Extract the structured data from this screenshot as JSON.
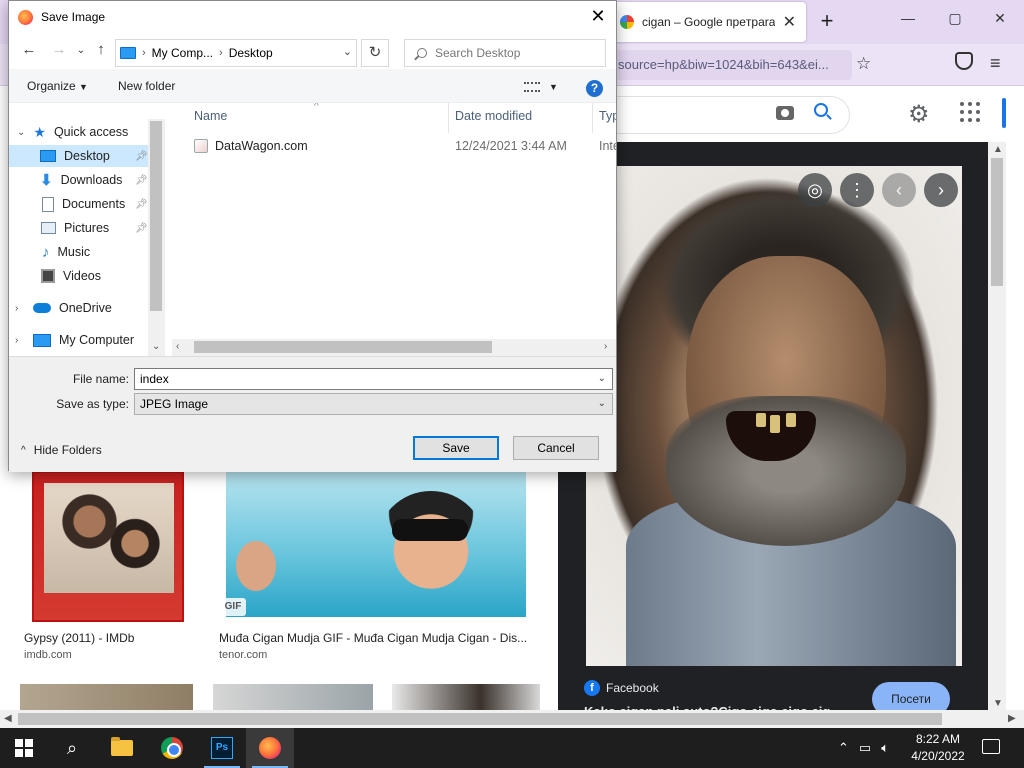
{
  "firefox": {
    "tab_title": "cigan – Google пpeтpara",
    "url_text": "source=hp&biw=1024&bih=643&ei...",
    "new_tab_symbol": "+",
    "window_controls": {
      "minimize": "—",
      "restore": "▢",
      "close": "✕"
    }
  },
  "results": [
    {
      "title": "Gypsy (2011) - IMDb",
      "source": "imdb.com"
    },
    {
      "title": "Muđa Cigan Mudja GIF - Muđa Cigan Mudja Cigan - Dis...",
      "source": "tenor.com",
      "badge": "GIF"
    }
  ],
  "preview": {
    "source_name": "Facebook",
    "visit_label": "Посети",
    "caption": "Kako cigan pali auto?Cigo cigo cigo cig..."
  },
  "taskbar": {
    "time": "8:22 AM",
    "date": "4/20/2022",
    "apps": [
      "start",
      "search",
      "file-explorer",
      "chrome",
      "photoshop",
      "firefox"
    ]
  },
  "dialog": {
    "title": "Save Image",
    "breadcrumb": [
      "My Comp...",
      "Desktop"
    ],
    "search_placeholder": "Search Desktop",
    "toolbar": {
      "organize": "Organize",
      "new_folder": "New folder"
    },
    "tree": [
      {
        "label": "Quick access",
        "icon": "star-icon"
      },
      {
        "label": "Desktop",
        "icon": "desktop-icon",
        "selected": true,
        "pinned": true
      },
      {
        "label": "Downloads",
        "icon": "download-icon",
        "pinned": true
      },
      {
        "label": "Documents",
        "icon": "document-icon",
        "pinned": true
      },
      {
        "label": "Pictures",
        "icon": "pictures-icon",
        "pinned": true
      },
      {
        "label": "Music",
        "icon": "music-icon"
      },
      {
        "label": "Videos",
        "icon": "video-icon"
      },
      {
        "label": "OneDrive",
        "icon": "cloud-icon"
      },
      {
        "label": "My Computer",
        "icon": "computer-icon"
      }
    ],
    "columns": [
      "Name",
      "Date modified",
      "Type"
    ],
    "files": [
      {
        "name": "DataWagon.com",
        "date": "12/24/2021 3:44 AM",
        "type": "Intern"
      }
    ],
    "file_name_label": "File name:",
    "file_name_value": "index",
    "save_type_label": "Save as type:",
    "save_type_value": "JPEG Image",
    "hide_folders": "Hide Folders",
    "save_label": "Save",
    "cancel_label": "Cancel"
  }
}
